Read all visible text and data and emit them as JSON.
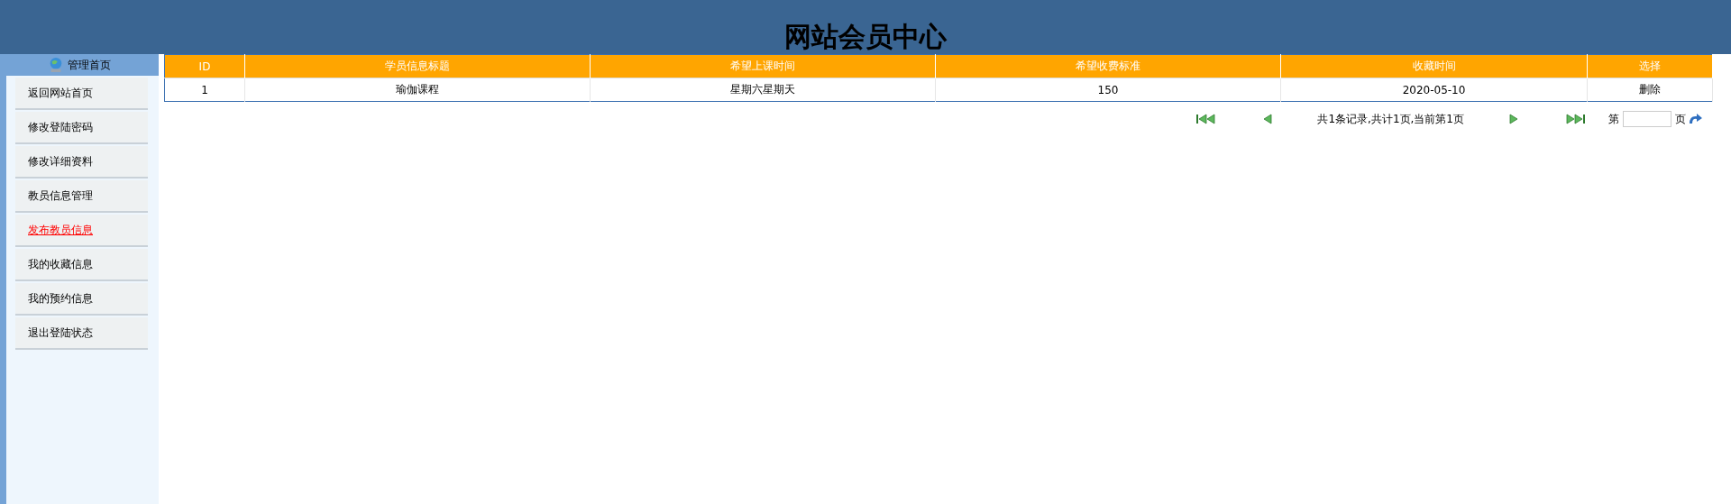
{
  "header": {
    "title": "网站会员中心"
  },
  "sidebar": {
    "heading": "管理首页",
    "items": [
      {
        "label": "返回网站首页",
        "selected": false
      },
      {
        "label": "修改登陆密码",
        "selected": false
      },
      {
        "label": "修改详细资料",
        "selected": false
      },
      {
        "label": "教员信息管理",
        "selected": false
      },
      {
        "label": "发布教员信息",
        "selected": true
      },
      {
        "label": "我的收藏信息",
        "selected": false
      },
      {
        "label": "我的预约信息",
        "selected": false
      },
      {
        "label": "退出登陆状态",
        "selected": false
      }
    ]
  },
  "table": {
    "columns": [
      "ID",
      "学员信息标题",
      "希望上课时间",
      "希望收费标准",
      "收藏时间",
      "选择"
    ],
    "rows": [
      {
        "cells": [
          "1",
          "瑜伽课程",
          "星期六星期天",
          "150",
          "2020-05-10"
        ],
        "action": "删除"
      }
    ]
  },
  "pagination": {
    "summary": "共1条记录,共计1页,当前第1页",
    "page_prefix": "第",
    "page_suffix": "页"
  }
}
